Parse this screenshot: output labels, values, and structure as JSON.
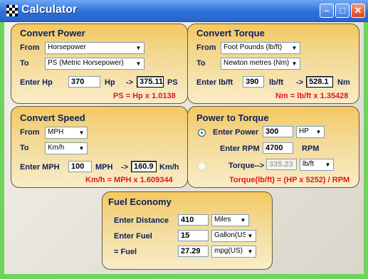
{
  "window": {
    "title": "Calculator"
  },
  "power": {
    "title": "Convert Power",
    "from_label": "From",
    "from_value": "Horsepower",
    "to_label": "To",
    "to_value": "PS (Metric Horsepower)",
    "enter_label": "Enter Hp",
    "input": "370",
    "unit_in": "Hp",
    "arrow": "->",
    "result": "375.11",
    "unit_out": "PS",
    "formula": "PS = Hp x 1.0138"
  },
  "torque": {
    "title": "Convert Torque",
    "from_label": "From",
    "from_value": "Foot Pounds (lb/ft)",
    "to_label": "To",
    "to_value": "Newton metres (Nm)",
    "enter_label": "Enter lb/ft",
    "input": "390",
    "unit_in": "lb/ft",
    "arrow": "->",
    "result": "528.1",
    "unit_out": "Nm",
    "formula": "Nm = lb/ft x 1.35428"
  },
  "speed": {
    "title": "Convert Speed",
    "from_label": "From",
    "from_value": "MPH",
    "to_label": "To",
    "to_value": "Km/h",
    "enter_label": "Enter MPH",
    "input": "100",
    "unit_in": "MPH",
    "arrow": "->",
    "result": "160.9",
    "unit_out": "Km/h",
    "formula": "Km/h = MPH x 1.609344"
  },
  "ptt": {
    "title": "Power to Torque",
    "power_label": "Enter Power",
    "power_value": "300",
    "power_unit": "HP",
    "rpm_label": "Enter RPM",
    "rpm_value": "4700",
    "rpm_unit": "RPM",
    "torque_label": "Torque-->",
    "torque_value": "335.23",
    "torque_unit": "lb/ft",
    "formula": "Torque(lb/ft) = (HP x 5252) / RPM"
  },
  "fuel": {
    "title": "Fuel Economy",
    "distance_label": "Enter Distance",
    "distance_value": "410",
    "distance_unit": "Miles",
    "fuel_label": "Enter Fuel",
    "fuel_value": "15",
    "fuel_unit": "Gallon(US)",
    "result_label": "= Fuel",
    "result_value": "27.29",
    "result_unit": "mpg(US)"
  },
  "colors": {
    "title_bar": "#2f6fd8",
    "panel": "#f5c860",
    "label": "#0b1f5c",
    "formula": "#e01818",
    "frame": "#6fd45a"
  }
}
